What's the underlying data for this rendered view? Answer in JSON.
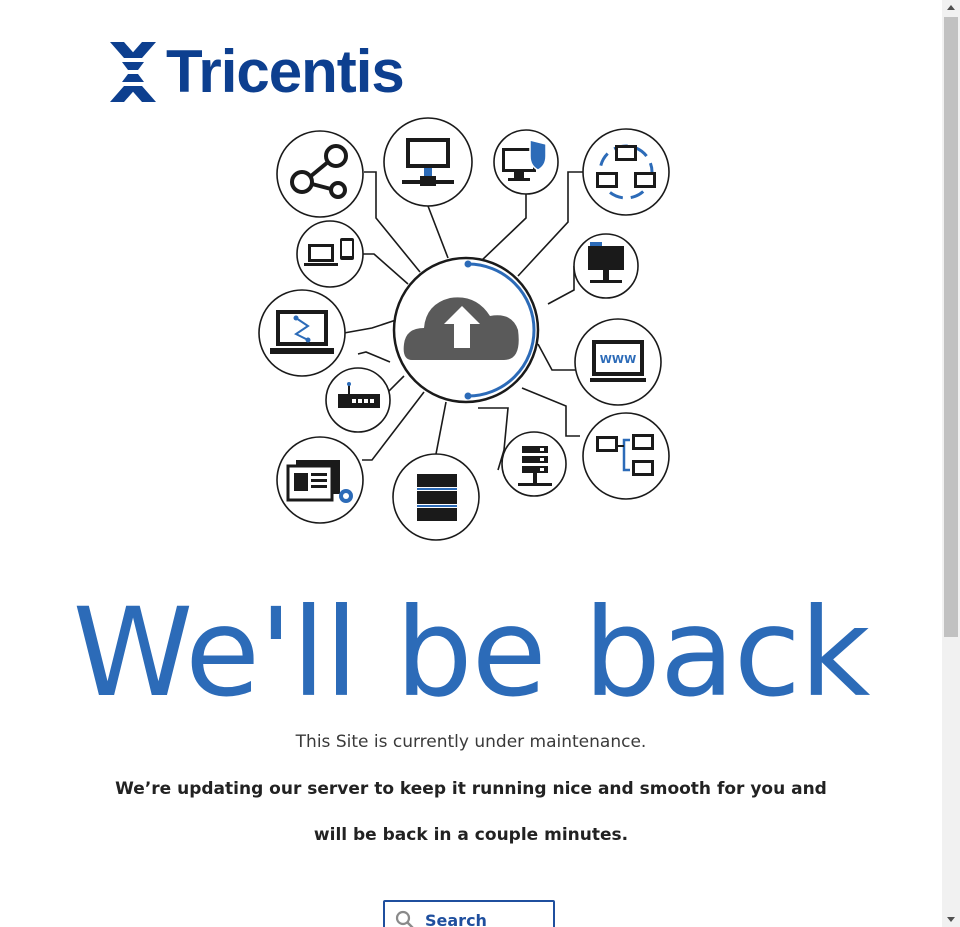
{
  "brand": {
    "name": "Tricentis",
    "color": "#0d3f8f"
  },
  "hero": {
    "nodes": [
      "share-icon",
      "monitor-network-icon",
      "monitor-shield-icon",
      "network-topology-icon",
      "devices-icon",
      "folder-server-icon",
      "laptop-workflow-icon",
      "www-monitor-icon",
      "router-icon",
      "network-computers-icon",
      "window-settings-icon",
      "database-stack-icon",
      "server-rack-icon"
    ],
    "center": "cloud-upload-icon"
  },
  "maintenance": {
    "headline": "We'll be back",
    "subtitle": "This Site is currently under maintenance.",
    "message": "We’re updating our server to keep it running nice and smooth for you and will be back in a couple minutes."
  },
  "search": {
    "placeholder": "Search"
  },
  "colors": {
    "accent": "#2c6bb8",
    "border": "#1f4f9e"
  }
}
